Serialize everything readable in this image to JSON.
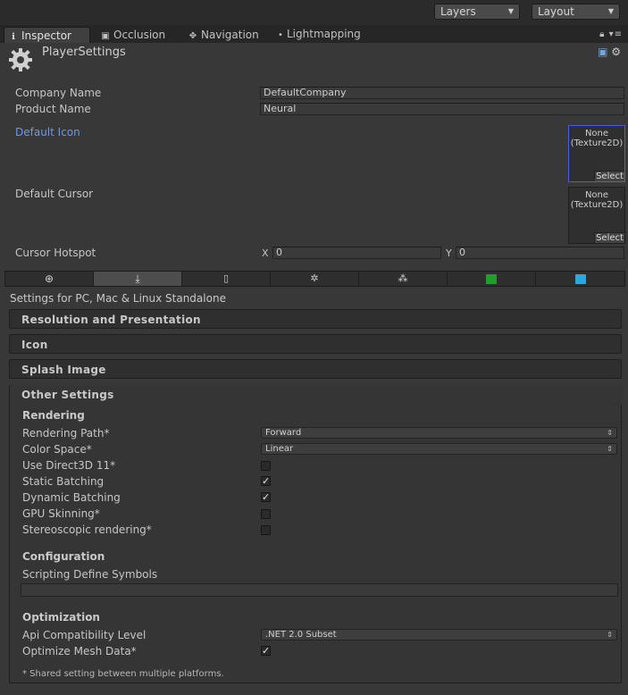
{
  "toolbar": {
    "layers": "Layers",
    "layout": "Layout"
  },
  "tabs": [
    {
      "label": "Inspector",
      "icon": "info-icon"
    },
    {
      "label": "Occlusion",
      "icon": "occlusion-icon"
    },
    {
      "label": "Navigation",
      "icon": "navigation-icon"
    },
    {
      "label": "Lightmapping",
      "icon": "lightbulb-icon"
    }
  ],
  "header": {
    "title": "PlayerSettings"
  },
  "fields": {
    "company_label": "Company Name",
    "company_value": "DefaultCompany",
    "product_label": "Product Name",
    "product_value": "Neural",
    "default_icon_label": "Default Icon",
    "default_cursor_label": "Default Cursor",
    "picker_none": "None",
    "picker_type": "(Texture2D)",
    "picker_select": "Select",
    "hotspot_label": "Cursor Hotspot",
    "hotspot_x_label": "X",
    "hotspot_x": "0",
    "hotspot_y_label": "Y",
    "hotspot_y": "0"
  },
  "platform_tabs": [
    "web",
    "standalone",
    "ios",
    "android",
    "blackberry",
    "windows-store",
    "windows-phone"
  ],
  "settings_for": "Settings for PC, Mac & Linux Standalone",
  "sections": {
    "resolution": "Resolution and Presentation",
    "icon": "Icon",
    "splash": "Splash Image",
    "other": "Other Settings"
  },
  "rendering": {
    "title": "Rendering",
    "rendering_path_label": "Rendering Path*",
    "rendering_path_value": "Forward",
    "color_space_label": "Color Space*",
    "color_space_value": "Linear",
    "d3d11_label": "Use Direct3D 11*",
    "static_batching_label": "Static Batching",
    "dynamic_batching_label": "Dynamic Batching",
    "gpu_skinning_label": "GPU Skinning*",
    "stereo_label": "Stereoscopic rendering*",
    "check": "✓"
  },
  "configuration": {
    "title": "Configuration",
    "scripting_label": "Scripting Define Symbols"
  },
  "optimization": {
    "title": "Optimization",
    "api_label": "Api Compatibility Level",
    "api_value": ".NET 2.0 Subset",
    "mesh_label": "Optimize Mesh Data*"
  },
  "footnote": "* Shared setting between multiple platforms.",
  "colors": {
    "accent": "#6f97e8",
    "selection": "#4a5fe0",
    "winstore": "#1f9e2c",
    "winphone": "#2ca7e0"
  }
}
